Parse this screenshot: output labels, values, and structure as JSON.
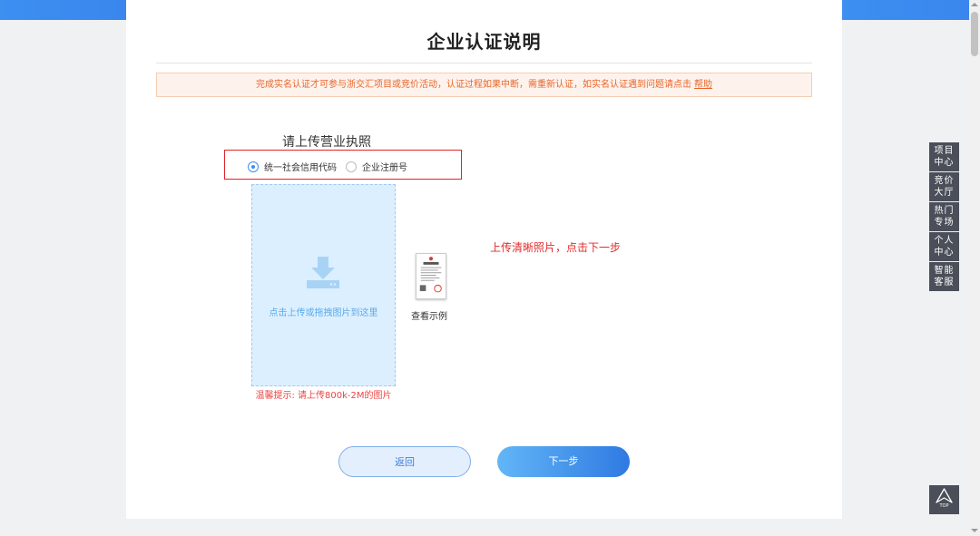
{
  "page": {
    "title": "企业认证说明",
    "notice_text": "完成实名认证才可参与浙交汇项目或竞价活动，认证过程如果中断，需重新认证，如实名认证遇到问题请点击",
    "notice_link": "帮助"
  },
  "upload": {
    "section_label": "请上传营业执照",
    "options": [
      {
        "label": "统一社会信用代码",
        "selected": true
      },
      {
        "label": "企业注册号",
        "selected": false
      }
    ],
    "dropzone_text": "点击上传或拖拽图片到这里",
    "size_tip": "温馨提示: 请上传800k-2M的图片",
    "sample_label": "查看示例",
    "instruction": "上传清晰照片，点击下一步"
  },
  "buttons": {
    "back": "返回",
    "next": "下一步"
  },
  "side_nav": [
    {
      "line1": "项目",
      "line2": "中心"
    },
    {
      "line1": "竞价",
      "line2": "大厅"
    },
    {
      "line1": "热门",
      "line2": "专场"
    },
    {
      "line1": "个人",
      "line2": "中心"
    },
    {
      "line1": "智能",
      "line2": "客服"
    }
  ],
  "top_button": {
    "label": "TOP",
    "icon": "arrow-up-icon"
  },
  "colors": {
    "accent": "#3c8ef0",
    "notice": "#e9652a",
    "warning": "#e32a2a",
    "side_nav_bg": "#4b4f59"
  }
}
